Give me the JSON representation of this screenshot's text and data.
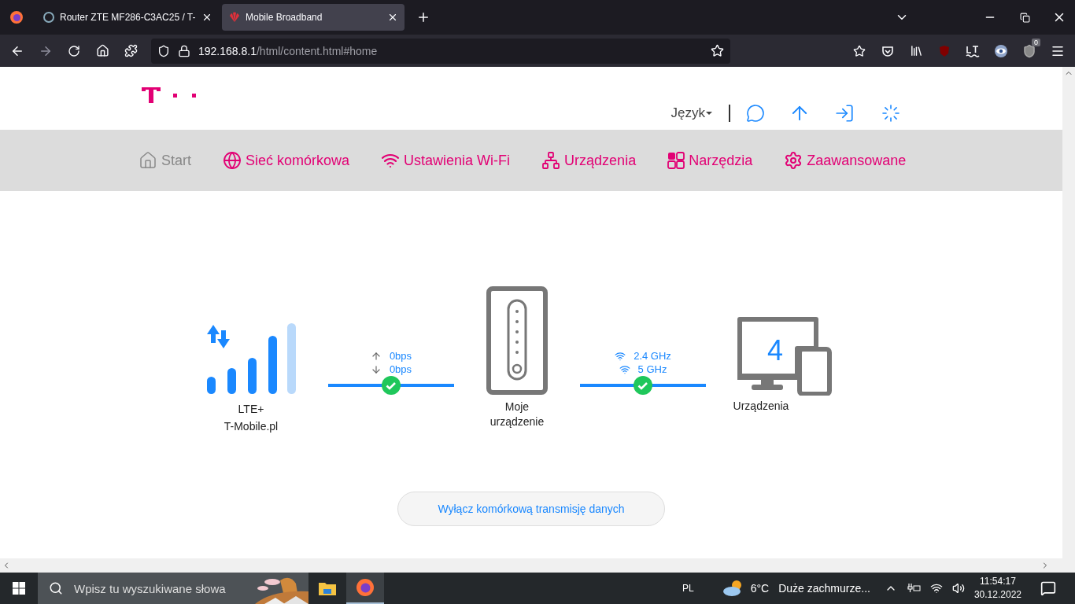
{
  "browser": {
    "tabs": [
      {
        "title": "Router ZTE MF286-C3AC25 / T-",
        "selected": false
      },
      {
        "title": "Mobile Broadband",
        "selected": true
      }
    ],
    "url": {
      "host": "192.168.8.1",
      "path": "/html/content.html#home"
    },
    "extension_badge": "0"
  },
  "header": {
    "language": "Język"
  },
  "nav": [
    {
      "label": "Start",
      "selected": true
    },
    {
      "label": "Sieć komórkowa",
      "selected": false
    },
    {
      "label": "Ustawienia Wi-Fi",
      "selected": false
    },
    {
      "label": "Urządzenia",
      "selected": false
    },
    {
      "label": "Narzędzia",
      "selected": false
    },
    {
      "label": "Zaawansowane",
      "selected": false
    }
  ],
  "status": {
    "network_type": "LTE+",
    "operator": "T-Mobile.pl",
    "upload": "0bps",
    "download": "0bps",
    "device_label": "Moje urządzenie",
    "wifi_bands": [
      "2.4 GHz",
      "5 GHz"
    ],
    "device_count": "4",
    "devices_label": "Urządzenia"
  },
  "action_button": "Wyłącz komórkową transmisję danych",
  "taskbar": {
    "search_placeholder": "Wpisz tu wyszukiwane słowa",
    "language": "PL",
    "temperature": "6°C",
    "weather": "Duże zachmurze...",
    "time": "11:54:17",
    "date": "30.12.2022"
  }
}
